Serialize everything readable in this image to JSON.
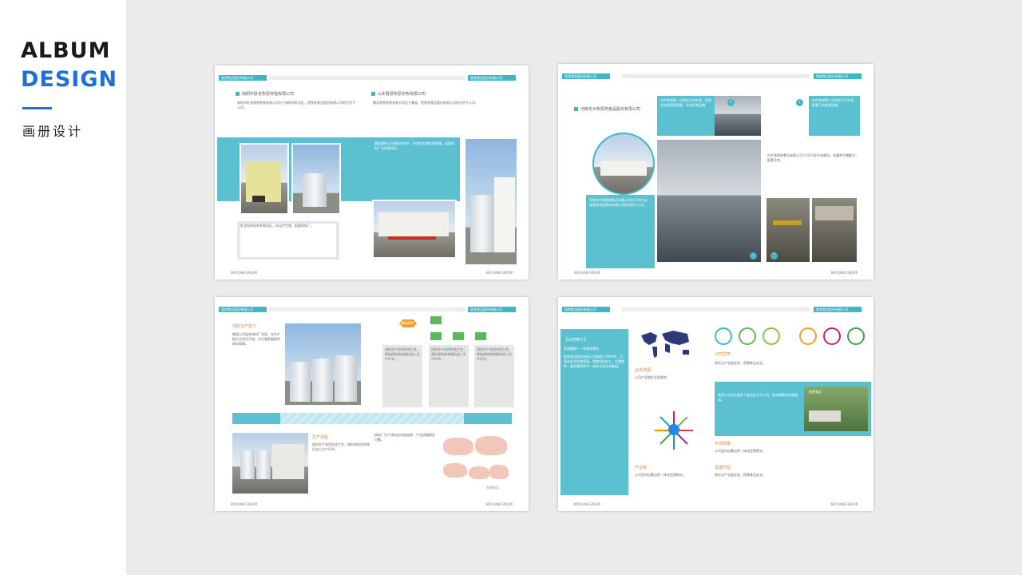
{
  "sidebar": {
    "title_line1": "ALBUM",
    "title_line2": "DESIGN",
    "subtitle": "画册设计"
  },
  "colors": {
    "accent_blue": "#1f6fd6",
    "teal": "#5bc1d1",
    "dark_teal": "#3fb6c8",
    "light_teal": "#cfeef3",
    "background": "#ebebeb"
  },
  "spread1": {
    "header_left": "牧原食品股份有限公司",
    "header_right": "牧原食品股份有限公司",
    "left_heading": "南阳市卧龙牧原养殖有限公司",
    "right_heading": "山东曹县牧原农牧有限公司",
    "left_text": "南阳市卧龙牧原养殖有限公司位于南阳市卧龙区，是牧原食品股份有限公司的全资子公司。",
    "right_text": "曹县牧原农牧有限公司位于曹县，是牧原食品股份有限公司的全资子公司。",
    "teal_text": "曹县牧原公司建成并投产，年出栏生猪达到规模，配套饲料厂及养殖场区。",
    "caption": "卧龙牧原现有养殖场区，年出栏生猪，配套饲料厂。",
    "foot_left": "MUYUAN GROUP",
    "foot_right": "MUYUAN GROUP"
  },
  "spread2": {
    "header_left": "牧原食品股份有限公司",
    "header_right": "牧原食品股份有限公司",
    "heading": "河南龙大牧原肉食品股份有限公司",
    "circle_text": "河南龙大牧原肉食品有限公司位于内乡县，是牧原食品股份有限公司的控股子公司。",
    "teal_box1": "内乡牧原第一分场位于内乡县，采用自动化养殖设备，年出栏商品猪。",
    "teal_box2": "内乡牧原第二分场位于内乡县，配套污水处理设施。",
    "right_text": "内乡牧原肉食品有限公司于2013年开始建设，年屠宰生猪能力，配套冷库。",
    "foot_left": "MUYUAN GROUP",
    "foot_right": "MUYUAN GROUP"
  },
  "spread3": {
    "header_left": "牧原食品股份有限公司",
    "header_right": "牧原食品股份有限公司",
    "heading": "饲料生产能力",
    "left_text": "集团公司现有饲料厂多家，年生产能力达到百万吨，为生猪养殖提供饲料保障。",
    "flow_top": "原料采购",
    "col_text": "饲料生产采用先进工艺，原料经检验合格后进入生产环节。",
    "heading2": "生产流程",
    "bottom_text": "饲料厂生产线自动化程度高，产品质量稳定可靠。",
    "watermark_caption": "牧原食品",
    "foot_left": "MUYUAN GROUP",
    "foot_right": "MUYUAN GROUP"
  },
  "spread4": {
    "header_left": "牧原食品股份有限公司",
    "header_right": "牧原食品股份有限公司",
    "teal_title": "【公司简介】",
    "teal_sub": "牧原集团——养殖规模化",
    "teal_text": "牧原食品股份有限公司始建于1992年，主营业务为生猪养殖，是集饲料加工、生猪育种、商品猪饲养为一体的大型企业集团。",
    "heading_a": "业务范围",
    "heading_b": "产业链",
    "heading_c": "公司优势",
    "heading_d": "市场规模",
    "heading_e": "发展历程",
    "map_caption": "公司产品销往全国各地",
    "box_text": "牧原公司在全国多个省份设立子公司，形成规模化养殖格局。",
    "photo_label": "牧原食品",
    "text_a": "公司坚持自繁自养一体化经营模式。",
    "text_b": "依托全产业链优势，保障食品安全。",
    "ring_labels": [
      "饲料",
      "育种",
      "养殖",
      "屠宰",
      "销售",
      "物流"
    ],
    "foot_left": "MUYUAN GROUP",
    "foot_right": "MUYUAN GROUP"
  }
}
